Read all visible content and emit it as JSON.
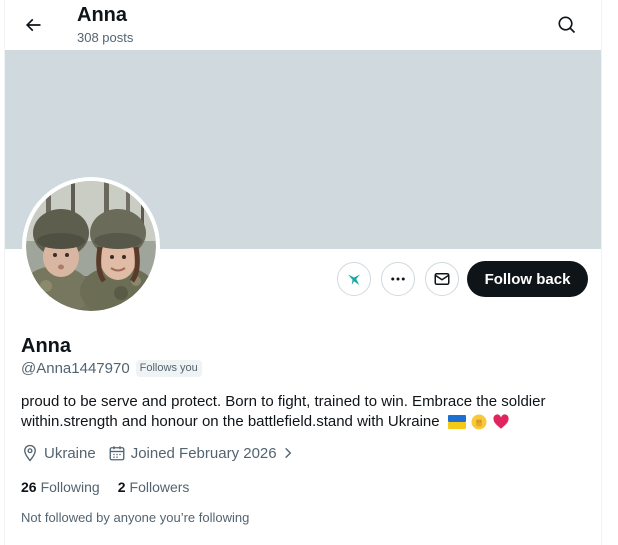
{
  "header": {
    "title": "Anna",
    "subtitle": "308 posts",
    "back_icon": "arrow-left-icon",
    "search_icon": "search-icon"
  },
  "banner": {
    "color": "#cfd9de"
  },
  "actions": {
    "grok_icon": "grok-icon",
    "more_icon": "more-dots-icon",
    "message_icon": "envelope-icon",
    "follow_back_label": "Follow back"
  },
  "profile": {
    "name": "Anna",
    "handle": "@Anna1447970",
    "follows_you": "Follows you",
    "bio": "proud to be serve and protect. Born to fight, trained to win. Embrace the soldier within.strength and honour on the battlefield.stand with Ukraine",
    "bio_emojis": [
      "flag-ukraine",
      "raised-fist",
      "red-heart"
    ],
    "location": "Ukraine",
    "joined": "Joined February 2026",
    "following_count": "26",
    "following_label": "Following",
    "followers_count": "2",
    "followers_label": "Followers",
    "not_followed": "Not followed by anyone you’re following"
  },
  "colors": {
    "text": "#0f1419",
    "muted": "#536471",
    "accent": "#0f1419"
  }
}
